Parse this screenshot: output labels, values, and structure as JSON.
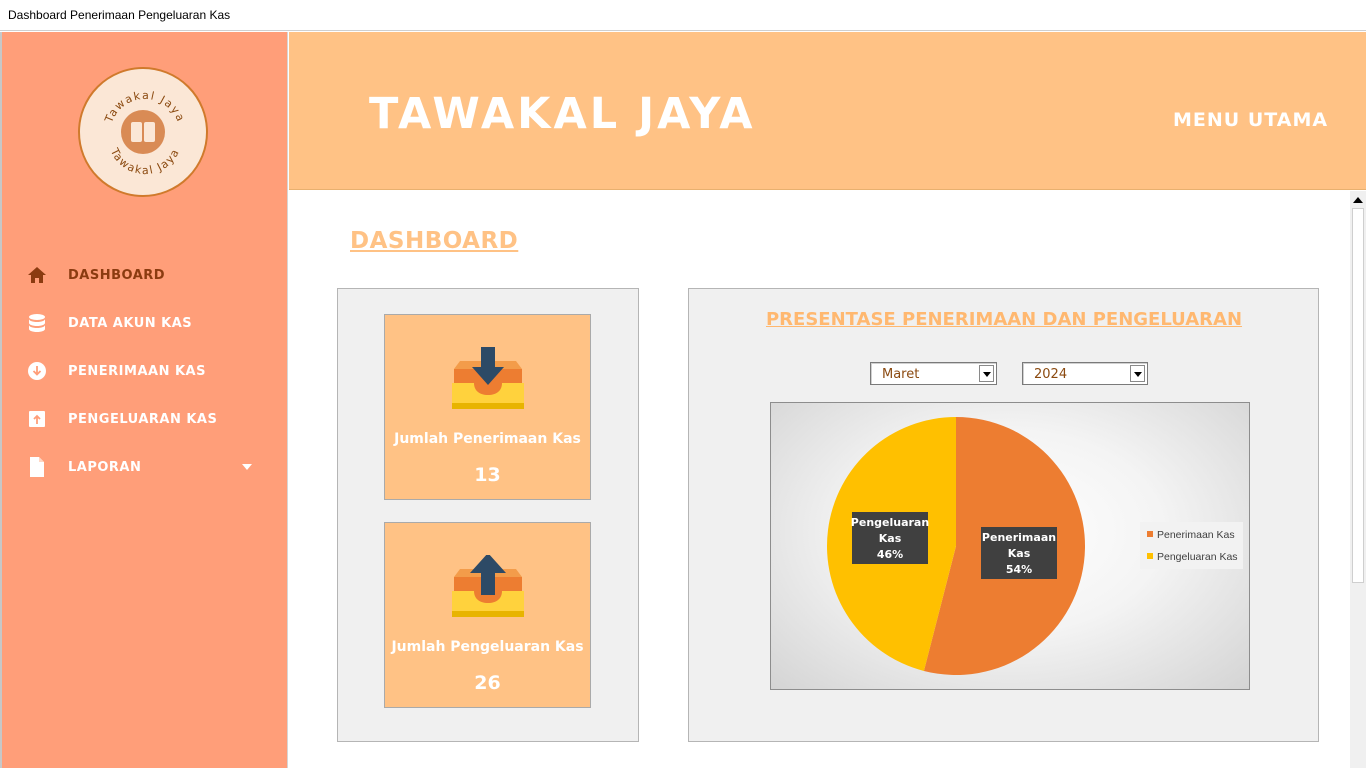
{
  "window": {
    "title": "Dashboard Penerimaan Pengeluaran Kas"
  },
  "sidebar": {
    "logo": {
      "ring_text": "Tawakal Jaya"
    },
    "items": [
      {
        "label": "DASHBOARD",
        "icon": "home-icon",
        "active": true
      },
      {
        "label": "DATA AKUN KAS",
        "icon": "database-icon",
        "active": false
      },
      {
        "label": "PENERIMAAN KAS",
        "icon": "arrow-down-circle-icon",
        "active": false
      },
      {
        "label": "PENGELUARAN KAS",
        "icon": "arrow-up-box-icon",
        "active": false
      },
      {
        "label": "LAPORAN",
        "icon": "document-icon",
        "active": false,
        "has_submenu": true
      }
    ]
  },
  "header": {
    "brand": "TAWAKAL JAYA",
    "menu": "MENU UTAMA"
  },
  "main": {
    "title": "DASHBOARD",
    "cards": [
      {
        "label": "Jumlah Penerimaan Kas",
        "value": "13",
        "icon": "inbox-download-icon"
      },
      {
        "label": "Jumlah Pengeluaran Kas",
        "value": "26",
        "icon": "inbox-upload-icon"
      }
    ],
    "chart_panel": {
      "title": "PRESENTASE PENERIMAAN DAN PENGELUARAN",
      "month": "Maret",
      "year": "2024"
    }
  },
  "colors": {
    "sidebar_bg": "#ff9e79",
    "header_bg": "#ffc285",
    "accent": "#ffc285",
    "active_text": "#8b3b10",
    "pie_penerimaan": "#ed7d31",
    "pie_pengeluaran": "#ffc000"
  },
  "chart_data": {
    "type": "pie",
    "categories": [
      "Penerimaan Kas",
      "Pengeluaran Kas"
    ],
    "values": [
      54,
      46
    ],
    "data_labels": [
      {
        "name": "Penerimaan Kas",
        "lines": [
          "Penerimaan",
          "Kas",
          "54%"
        ]
      },
      {
        "name": "Pengeluaran Kas",
        "lines": [
          "Pengeluaran",
          "Kas",
          "46%"
        ]
      }
    ],
    "legend": [
      "Penerimaan Kas",
      "Pengeluaran Kas"
    ],
    "legend_position": "right"
  }
}
